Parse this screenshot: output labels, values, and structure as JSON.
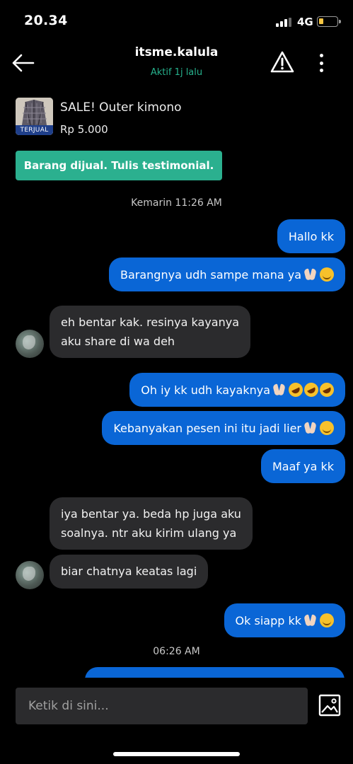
{
  "status_bar": {
    "time": "20.34",
    "network": "4G"
  },
  "header": {
    "username": "itsme.kalula",
    "last_seen": "Aktif 1j lalu"
  },
  "product": {
    "name": "SALE! Outer kimono",
    "price": "Rp 5.000",
    "badge": "TERJUAL"
  },
  "sold_banner": "Barang dijual. Tulis testimonial.",
  "date_separators": [
    "Kemarin 11:26 AM",
    "06:26 AM"
  ],
  "messages": [
    {
      "side": "out",
      "text": "Hallo kk"
    },
    {
      "side": "out",
      "text": "Barangnya udh sampe mana ya",
      "emoji": [
        "pray",
        "hug"
      ]
    },
    {
      "side": "in",
      "text_lines": [
        "eh bentar kak. resinya kayanya",
        "aku share di wa deh"
      ]
    },
    {
      "side": "out",
      "text": "Oh iy kk udh kayaknya",
      "emoji": [
        "pray",
        "rofl",
        "rofl",
        "rofl"
      ]
    },
    {
      "side": "out",
      "text": "Kebanyakan pesen ini itu jadi lier",
      "emoji": [
        "pray",
        "hug"
      ]
    },
    {
      "side": "out",
      "text": "Maaf ya kk"
    },
    {
      "side": "in",
      "text_lines": [
        "iya bentar ya. beda hp juga aku",
        "soalnya. ntr aku kirim ulang ya"
      ]
    },
    {
      "side": "in",
      "text_lines": [
        "biar chatnya keatas lagi"
      ]
    },
    {
      "side": "out",
      "text": "Ok siapp kk",
      "emoji": [
        "pray",
        "hug"
      ]
    }
  ],
  "composer": {
    "placeholder": "Ketik di sini..."
  },
  "icons": {
    "back": "arrow-left-icon",
    "report": "warning-triangle-icon",
    "more": "more-vertical-icon",
    "gallery": "image-gallery-icon"
  },
  "colors": {
    "outgoing_bubble": "#0a66d6",
    "incoming_bubble": "#2b2b2d",
    "accent_green": "#2bb08f",
    "status_text_green": "#26b08c"
  }
}
